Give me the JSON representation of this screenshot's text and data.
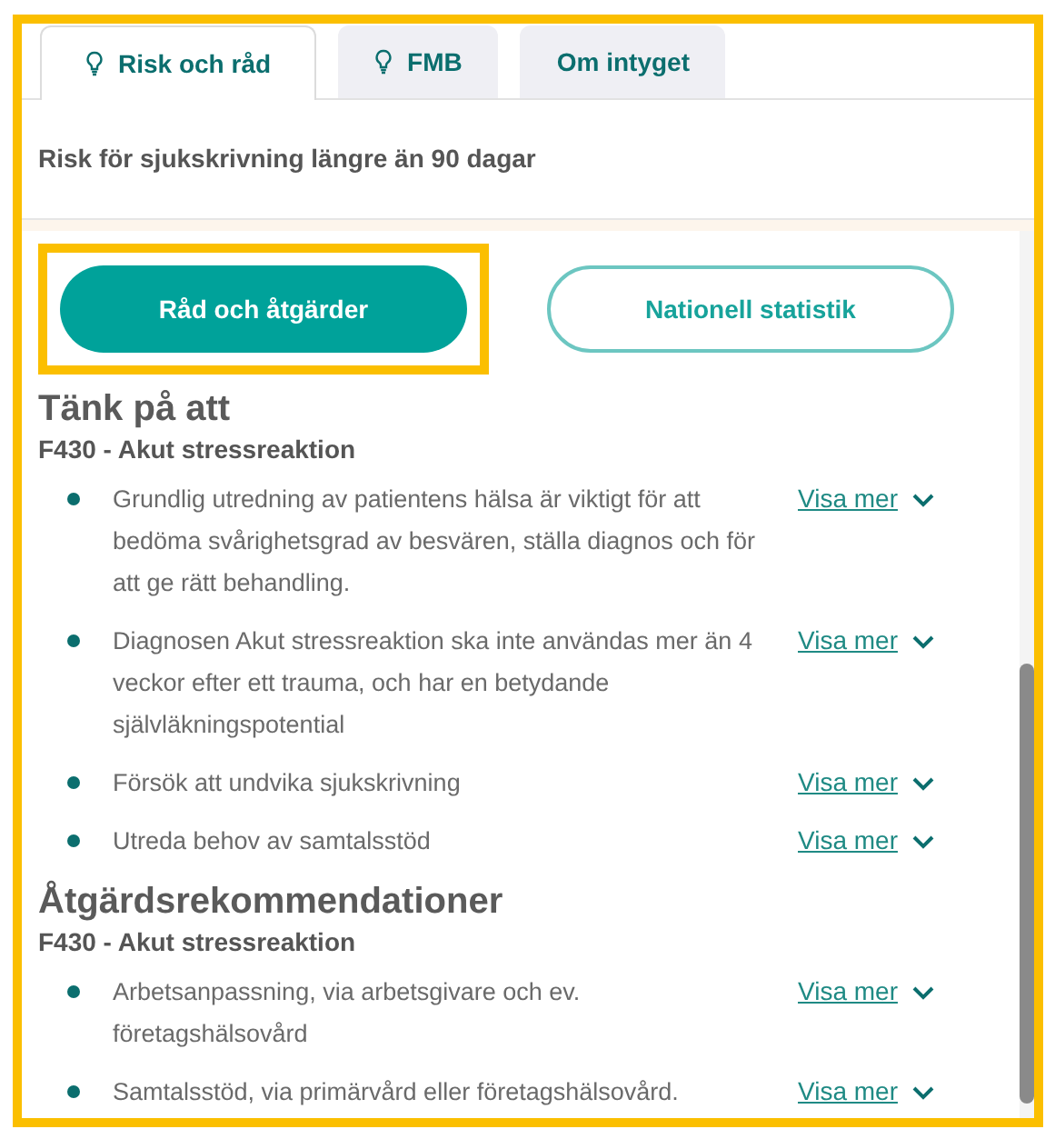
{
  "panel": {
    "highlighted": true
  },
  "tabs": [
    {
      "label": "Risk och råd",
      "selected": true,
      "has_icon": true
    },
    {
      "label": "FMB",
      "selected": false,
      "has_icon": true
    },
    {
      "label": "Om intyget",
      "selected": false,
      "has_icon": false
    }
  ],
  "risk_heading": "Risk för sjukskrivning längre än 90 dagar",
  "buttons": [
    {
      "label": "Råd och åtgärder",
      "selected": true,
      "highlighted": true
    },
    {
      "label": "Nationell statistik",
      "selected": false,
      "highlighted": false
    }
  ],
  "sections": [
    {
      "title": "Tänk på att",
      "subtitle": "F430 - Akut stressreaktion",
      "items": [
        {
          "text": "Grundlig utredning av patientens hälsa är viktigt för att bedöma svårighetsgrad av besvären, ställa diagnos och för att ge rätt behandling.",
          "link": "Visa mer",
          "expanded": false
        },
        {
          "text": "Diagnosen Akut stressreaktion ska inte användas mer än 4 veckor efter ett trauma, och har en betydande självläkningspotential",
          "link": "Visa mer",
          "expanded": false
        },
        {
          "text": "Försök att undvika sjukskrivning",
          "link": "Visa mer",
          "expanded": false
        },
        {
          "text": "Utreda behov av samtalsstöd",
          "link": "Visa mer",
          "expanded": false
        }
      ]
    },
    {
      "title": "Åtgärdsrekommendationer",
      "subtitle": "F430 - Akut stressreaktion",
      "items": [
        {
          "text": "Arbetsanpassning, via arbetsgivare och ev. företagshälsovård",
          "link": "Visa mer",
          "expanded": false
        },
        {
          "text": "Samtalsstöd, via primärvård eller företagshälsovård.",
          "link": "Visa mer",
          "expanded": false
        }
      ]
    }
  ]
}
